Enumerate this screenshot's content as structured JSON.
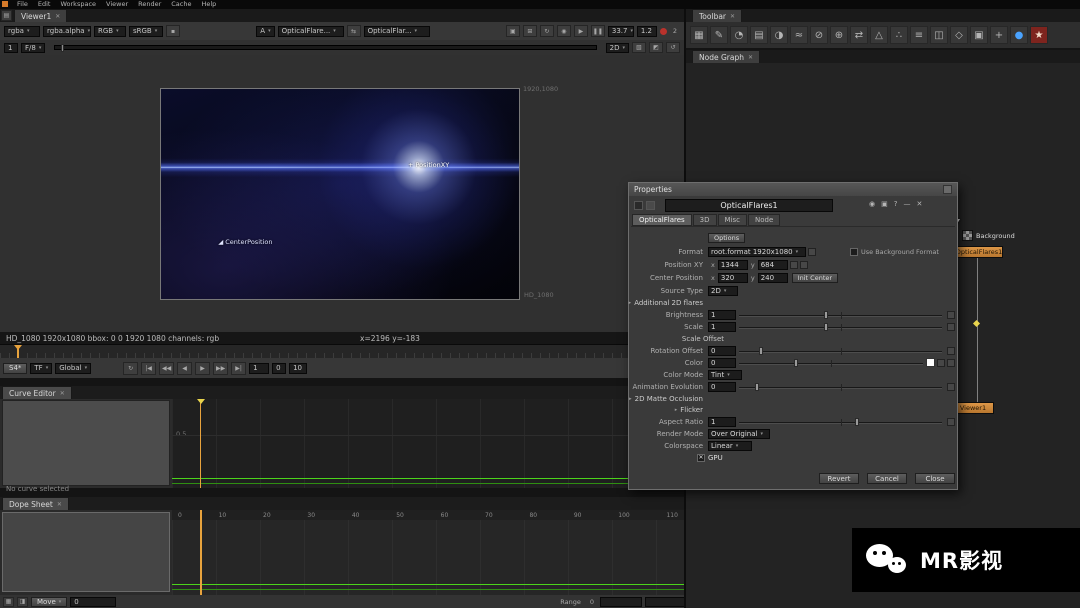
{
  "colors": {
    "accent_orange": "#e8a33d",
    "node_orange": "#d08a3e",
    "playhead": "#f0a830",
    "curve_green": "#4cd41b",
    "flare_blue": "#4a6aff",
    "record_red": "#b9322c"
  },
  "menubar": {
    "items": [
      "File",
      "Edit",
      "Workspace",
      "Viewer",
      "Render",
      "Cache",
      "Help"
    ]
  },
  "viewer": {
    "tab": "Viewer1",
    "channels": "rgba",
    "alpha": "rgba.alpha",
    "display": "RGB",
    "lut": "sRGB",
    "a_label": "A",
    "a_input": "OpticalFlare...",
    "b_input": "OpticalFlar...",
    "gain": "33.7",
    "gamma": "1.2",
    "view_badge": "2",
    "frame": "1",
    "fstop": "F/8",
    "mode": "2D",
    "icons1": [
      {
        "g": "▣",
        "name": "framestore-icon"
      },
      {
        "g": "⊞",
        "name": "roi-icon"
      },
      {
        "g": "↻",
        "name": "refresh-icon"
      },
      {
        "g": "◉",
        "name": "proxy-icon"
      },
      {
        "g": "▶",
        "name": "play-icon"
      },
      {
        "g": "❚❚",
        "name": "pause-icon"
      }
    ],
    "icons2": [
      {
        "g": "▧",
        "name": "downrez-icon"
      },
      {
        "g": "◩",
        "name": "wipe-icon"
      },
      {
        "g": "↺",
        "name": "update-icon"
      }
    ],
    "overlay": {
      "resolution": "1920,1080",
      "format": "HD_1080",
      "position_label": "PositionXY",
      "center_label": "CenterPosition"
    },
    "status": "HD_1080 1920x1080 bbox: 0 0 1920 1080 channels: rgb",
    "coords": "x=2196 y=-183"
  },
  "transport": {
    "lock": "S4*",
    "tf": "TF",
    "range": "Global",
    "buttons": [
      {
        "g": "↻",
        "name": "loop-button"
      },
      {
        "g": "|◀",
        "name": "first-frame-button"
      },
      {
        "g": "◀◀",
        "name": "prev-keyframe-button"
      },
      {
        "g": "◀",
        "name": "step-back-button"
      },
      {
        "g": "▶",
        "name": "play-button"
      },
      {
        "g": "▶▶",
        "name": "next-keyframe-button"
      },
      {
        "g": "▶|",
        "name": "last-frame-button"
      }
    ],
    "frame": "1",
    "step": "0",
    "fps": "10"
  },
  "curve_editor": {
    "tab": "Curve Editor",
    "y_label": "0.5",
    "empty": "No curve selected"
  },
  "dope_sheet": {
    "tab": "Dope Sheet",
    "ruler": [
      "0",
      "10",
      "20",
      "30",
      "40",
      "50",
      "60",
      "70",
      "80",
      "90",
      "100",
      "110"
    ]
  },
  "bottom_bar": {
    "tool": "Move",
    "value": "0",
    "range_label": "Range",
    "range_value": "0"
  },
  "toolbar_panel": {
    "tab": "Toolbar",
    "icons": [
      {
        "glyph": "▦",
        "name": "image-icon"
      },
      {
        "glyph": "✎",
        "name": "draw-icon"
      },
      {
        "glyph": "◔",
        "name": "time-icon"
      },
      {
        "glyph": "▤",
        "name": "channel-icon"
      },
      {
        "glyph": "◑",
        "name": "color-icon"
      },
      {
        "glyph": "≈",
        "name": "filter-icon"
      },
      {
        "glyph": "⊘",
        "name": "keyer-icon"
      },
      {
        "glyph": "⊕",
        "name": "merge-icon"
      },
      {
        "glyph": "⇄",
        "name": "transform-icon"
      },
      {
        "glyph": "△",
        "name": "3d-icon"
      },
      {
        "glyph": "∴",
        "name": "particles-icon"
      },
      {
        "glyph": "≡",
        "name": "deep-icon"
      },
      {
        "glyph": "◫",
        "name": "views-icon"
      },
      {
        "glyph": "◇",
        "name": "metadata-icon"
      },
      {
        "glyph": "▣",
        "name": "toolsets-icon"
      },
      {
        "glyph": "+",
        "name": "other-icon"
      },
      {
        "glyph": "●",
        "name": "ofx-icon"
      },
      {
        "glyph": "★",
        "name": "videocopilot-icon"
      }
    ]
  },
  "node_graph": {
    "tab": "Node Graph",
    "nodes": {
      "background": "Background",
      "optical_flares": "OpticalFlares1",
      "viewer": "Viewer1"
    }
  },
  "properties": {
    "window_title": "Properties",
    "node_name": "OpticalFlares1",
    "tabs": [
      "OpticalFlares",
      "3D",
      "Misc",
      "Node"
    ],
    "header_icons": [
      {
        "g": "◉",
        "name": "center-node-icon"
      },
      {
        "g": "▣",
        "name": "float-window-icon"
      },
      {
        "g": "?",
        "name": "help-icon"
      },
      {
        "g": "—",
        "name": "minimize-icon"
      },
      {
        "g": "✕",
        "name": "close-icon"
      }
    ],
    "options": "Options",
    "format": {
      "label": "Format",
      "value": "root.format 1920x1080",
      "bg_label": "Use Background Format"
    },
    "position_xy": {
      "label": "Position XY",
      "x_label": "x",
      "x": "1344",
      "y_label": "y",
      "y": "684"
    },
    "center_position": {
      "label": "Center Position",
      "x_label": "x",
      "x": "320",
      "y_label": "y",
      "y": "240",
      "init": "Init Center"
    },
    "source_type": {
      "label": "Source Type",
      "value": "2D"
    },
    "additional_flares": "Additional 2D flares",
    "brightness": {
      "label": "Brightness",
      "value": "1"
    },
    "scale": {
      "label": "Scale",
      "value": "1"
    },
    "scale_offset": "Scale Offset",
    "rotation_offset": {
      "label": "Rotation Offset",
      "value": "0"
    },
    "color": {
      "label": "Color",
      "value": "0"
    },
    "color_mode": {
      "label": "Color Mode",
      "value": "Tint"
    },
    "animation_evolution": {
      "label": "Animation Evolution",
      "value": "0"
    },
    "matte_occlusion": "2D Matte Occlusion",
    "flicker": "Flicker",
    "aspect_ratio": {
      "label": "Aspect Ratio",
      "value": "1"
    },
    "render_mode": {
      "label": "Render Mode",
      "value": "Over Original"
    },
    "colorspace": {
      "label": "Colorspace",
      "value": "Linear"
    },
    "gpu": "GPU",
    "gpu_check": "✕",
    "buttons": {
      "revert": "Revert",
      "cancel": "Cancel",
      "close": "Close"
    }
  },
  "watermark": {
    "text": "MR影视"
  }
}
